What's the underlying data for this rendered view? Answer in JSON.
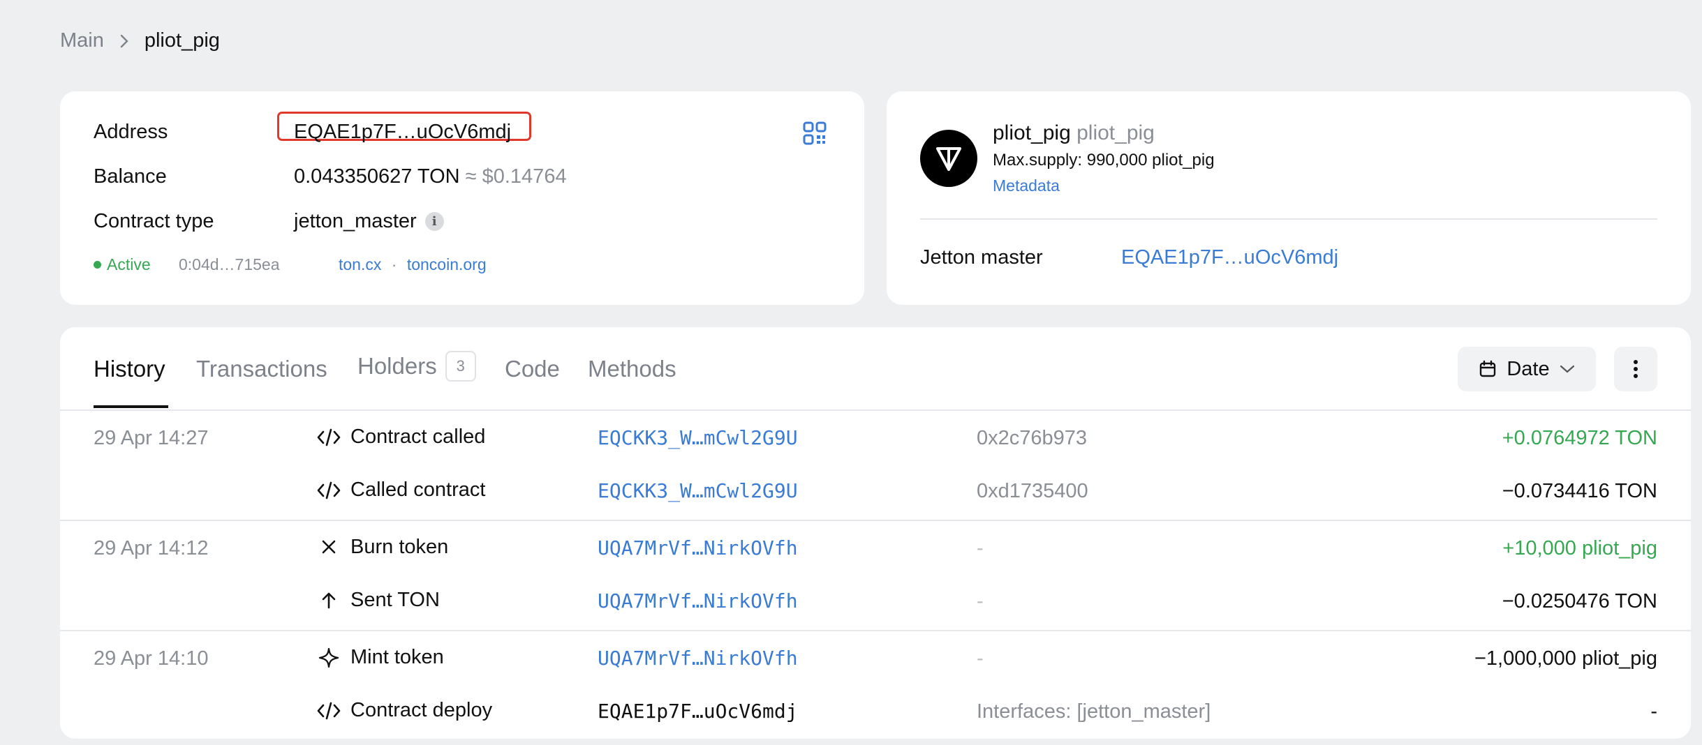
{
  "breadcrumb": {
    "home": "Main",
    "current": "pliot_pig"
  },
  "account": {
    "address_label": "Address",
    "address_value": "EQAE1p7F…uOcV6mdj",
    "balance_label": "Balance",
    "balance_value": "0.043350627 TON",
    "balance_usd": "≈ $0.14764",
    "contract_type_label": "Contract type",
    "contract_type_value": "jetton_master",
    "status": "Active",
    "code_hash": "0:04d…715ea",
    "link1": "ton.cx",
    "link_sep": "·",
    "link2": "toncoin.org"
  },
  "token": {
    "name": "pliot_pig",
    "symbol": "pliot_pig",
    "max_supply": "Max.supply: 990,000 pliot_pig",
    "metadata_link": "Metadata",
    "jetton_master_label": "Jetton master",
    "jetton_master_value": "EQAE1p7F…uOcV6mdj"
  },
  "tabs": [
    {
      "label": "History"
    },
    {
      "label": "Transactions"
    },
    {
      "label": "Holders",
      "badge": "3"
    },
    {
      "label": "Code"
    },
    {
      "label": "Methods"
    }
  ],
  "filter": {
    "date_label": "Date"
  },
  "colors": {
    "accent": "#3a7bd5",
    "positive": "#36a852",
    "highlight": "#e0392b"
  },
  "history": [
    {
      "date": "29 Apr 14:27",
      "icon": "code-icon",
      "action": "Contract called",
      "address": "EQCKK3_W…mCwl2G9U",
      "detail": "0x2c76b973",
      "amount": "+0.0764972 TON"
    },
    {
      "date": "",
      "icon": "code-icon",
      "action": "Called contract",
      "address": "EQCKK3_W…mCwl2G9U",
      "detail": "0xd1735400",
      "amount": "−0.0734416 TON"
    },
    {
      "date": "29 Apr 14:12",
      "icon": "close-icon",
      "action": "Burn token",
      "address": "UQA7MrVf…NirkOVfh",
      "detail": "-",
      "amount": "+10,000 pliot_pig"
    },
    {
      "date": "",
      "icon": "arrow-up-icon",
      "action": "Sent TON",
      "address": "UQA7MrVf…NirkOVfh",
      "detail": "-",
      "amount": "−0.0250476 TON"
    },
    {
      "date": "29 Apr 14:10",
      "icon": "sparkle-icon",
      "action": "Mint token",
      "address": "UQA7MrVf…NirkOVfh",
      "detail": "-",
      "amount": "−1,000,000 pliot_pig"
    },
    {
      "date": "",
      "icon": "code-icon",
      "action": "Contract deploy",
      "address": "EQAE1p7F…uOcV6mdj",
      "detail": "Interfaces: [jetton_master]",
      "amount": "-"
    }
  ]
}
